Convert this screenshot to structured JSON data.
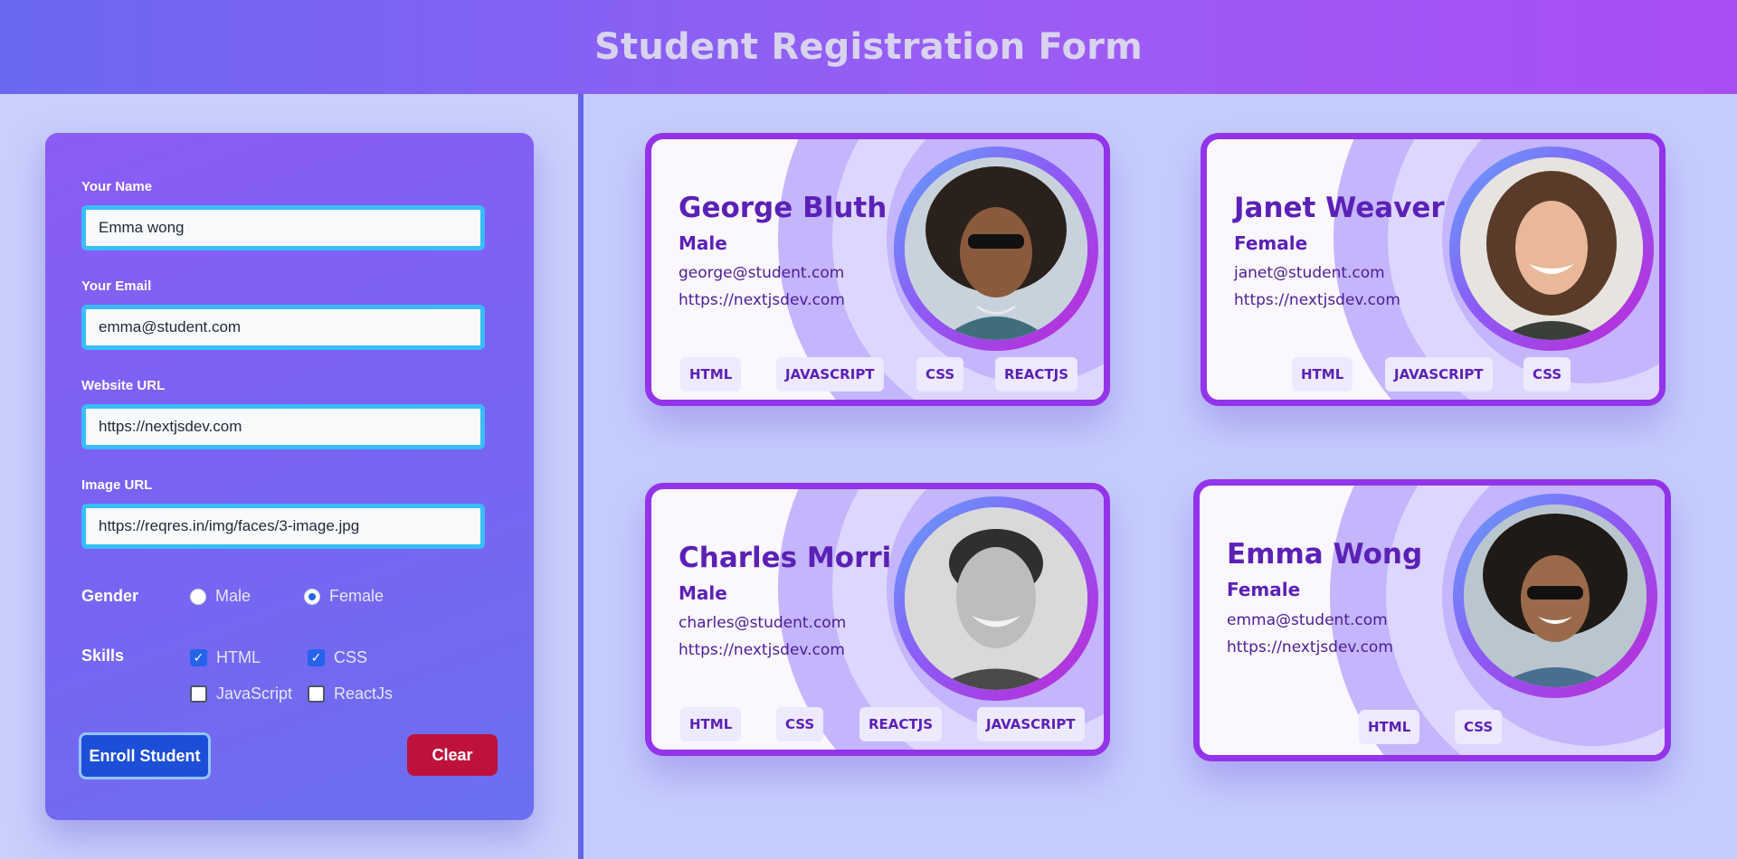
{
  "header": {
    "title": "Student Registration Form"
  },
  "form": {
    "name_label": "Your Name",
    "name_value": "Emma wong",
    "email_label": "Your Email",
    "email_value": "emma@student.com",
    "website_label": "Website URL",
    "website_value": "https://nextjsdev.com",
    "image_label": "Image URL",
    "image_value": "https://reqres.in/img/faces/3-image.jpg",
    "gender_label": "Gender",
    "gender_male": "Male",
    "gender_female": "Female",
    "gender_selected": "Female",
    "skills_label": "Skills",
    "skill_html": "HTML",
    "skill_css": "CSS",
    "skill_js": "JavaScript",
    "skill_react": "ReactJs",
    "skills_checked": [
      "HTML",
      "CSS"
    ],
    "enroll_label": "Enroll Student",
    "clear_label": "Clear"
  },
  "cards": [
    {
      "name": "George Bluth",
      "gender": "Male",
      "email": "george@student.com",
      "website": "https://nextjsdev.com",
      "skills": [
        "HTML",
        "JAVASCRIPT",
        "CSS",
        "REACTJS"
      ]
    },
    {
      "name": "Janet Weaver",
      "gender": "Female",
      "email": "janet@student.com",
      "website": "https://nextjsdev.com",
      "skills": [
        "HTML",
        "JAVASCRIPT",
        "CSS"
      ]
    },
    {
      "name": "Charles Morri",
      "gender": "Male",
      "email": "charles@student.com",
      "website": "https://nextjsdev.com",
      "skills": [
        "HTML",
        "CSS",
        "REACTJS",
        "JAVASCRIPT"
      ]
    },
    {
      "name": "Emma Wong",
      "gender": "Female",
      "email": "emma@student.com",
      "website": "https://nextjsdev.com",
      "skills": [
        "HTML",
        "CSS"
      ]
    }
  ],
  "colors": {
    "header_start": "#6a68f2",
    "header_end": "#a94ef5",
    "card_border": "#9333ea",
    "input_border": "#38bdf8",
    "enroll_button": "#1d4ed8",
    "clear_button": "#be123c"
  }
}
